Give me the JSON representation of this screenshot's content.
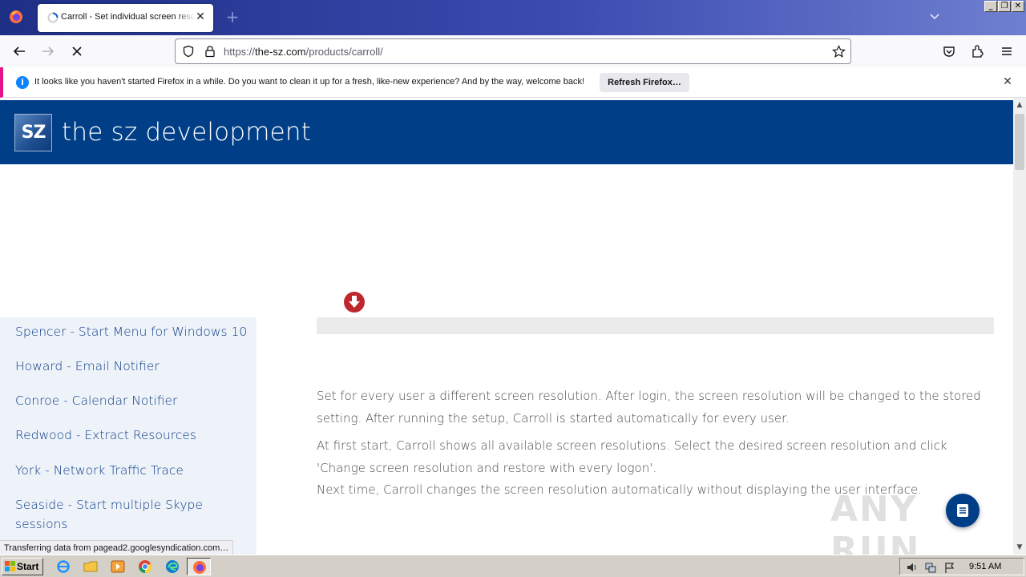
{
  "browser": {
    "tab_title": "Carroll - Set individual screen resolution",
    "new_tab_symbol": "+",
    "close_symbol": "✕",
    "url_prefix": "https://",
    "url_domain": "the-sz.com",
    "url_path": "/products/carroll/",
    "window_buttons": [
      "_",
      "❐",
      "✕"
    ]
  },
  "notification": {
    "info_symbol": "i",
    "text": "It looks like you haven't started Firefox in a while. Do you want to clean it up for a fresh, like-new experience? And by the way, welcome back!",
    "button_label": "Refresh Firefox…",
    "close_symbol": "✕"
  },
  "site": {
    "logo_text": "SZ",
    "title": "the sz development"
  },
  "sidebar": {
    "items": [
      {
        "label": "Spencer - Start Menu for Windows 10"
      },
      {
        "label": "Howard - Email Notifier"
      },
      {
        "label": "Conroe - Calendar Notifier"
      },
      {
        "label": "Redwood - Extract Resources"
      },
      {
        "label": "York - Network Traffic Trace"
      },
      {
        "label": "Seaside - Start multiple Skype sessions"
      }
    ]
  },
  "content": {
    "paragraph1": "Set for every user a different screen resolution. After login, the screen resolution will be changed to the stored setting. After running the setup, Carroll is started automatically for every user.",
    "paragraph2": "At first start, Carroll shows all available screen resolutions. Select the desired screen resolution and click 'Change screen resolution and restore with every logon'.",
    "paragraph3": "Next time, Carroll changes the screen resolution automatically without displaying the user interface."
  },
  "watermark": "ANY RUN",
  "status_text": "Transferring data from pagead2.googlesyndication.com…",
  "taskbar": {
    "start_label": "Start",
    "clock": "9:51 AM"
  },
  "colors": {
    "site_header": "#003f87",
    "sidebar_bg": "#eef3f9",
    "link": "#0b3a86",
    "download_icon": "#c0262d",
    "notification_accent": "#e31587"
  }
}
